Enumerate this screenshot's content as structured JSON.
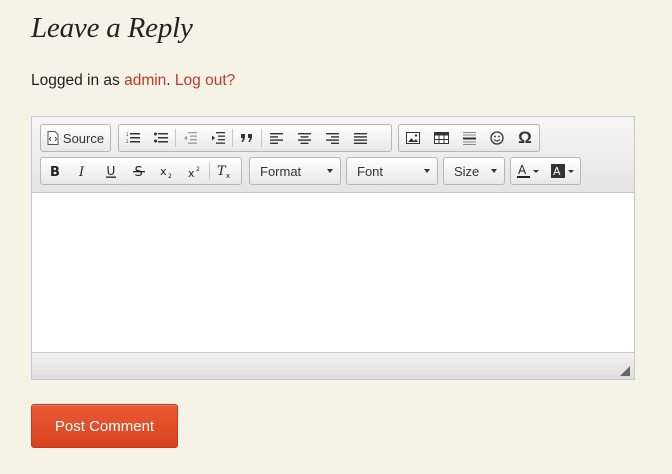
{
  "heading": "Leave a Reply",
  "logged_in": {
    "prefix": "Logged in as ",
    "user": "admin",
    "dot": ".",
    "logout": "Log out?"
  },
  "toolbar": {
    "source_label": "Source",
    "format_label": "Format",
    "font_label": "Font",
    "size_label": "Size",
    "superscript_mark": "2",
    "subscript_mark": "2",
    "clear_format_mark": "x",
    "special_char": "Ω"
  },
  "submit_label": "Post Comment",
  "colors": {
    "link": "#c0392b",
    "button": "#e05230",
    "background": "#f5f3e6"
  }
}
